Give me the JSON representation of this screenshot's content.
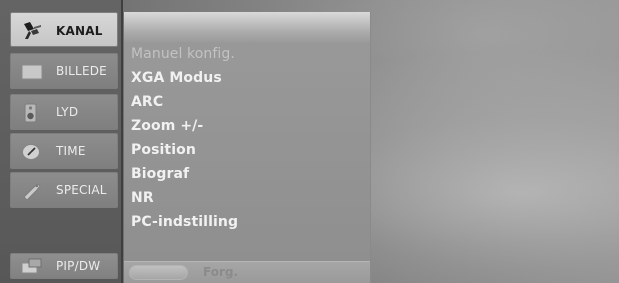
{
  "tabs": [
    {
      "label": "KANAL",
      "icon": "satellite-icon"
    },
    {
      "label": "BILLEDE",
      "icon": "picture-icon"
    },
    {
      "label": "LYD",
      "icon": "speaker-icon"
    },
    {
      "label": "TIME",
      "icon": "clock-icon"
    },
    {
      "label": "SPECIAL",
      "icon": "tag-icon"
    },
    {
      "label": "PIP/DW",
      "icon": "pip-icon"
    }
  ],
  "menu": {
    "items": [
      {
        "label": "Manuel konfig."
      },
      {
        "label": "XGA Modus"
      },
      {
        "label": "ARC"
      },
      {
        "label": "Zoom +/-"
      },
      {
        "label": "Position"
      },
      {
        "label": "Biograf"
      },
      {
        "label": "NR"
      },
      {
        "label": "PC-indstilling"
      }
    ],
    "footer_label": "Forg."
  }
}
